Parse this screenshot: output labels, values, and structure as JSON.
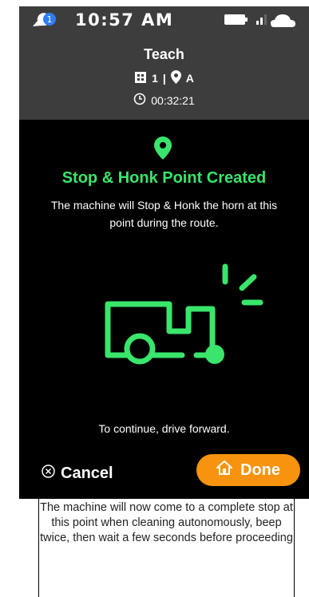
{
  "status_bar": {
    "time": "10:57 AM",
    "notification_count": "1",
    "icons": [
      "messenger-icon",
      "battery-icon",
      "signal-icon",
      "cloud-icon"
    ]
  },
  "header": {
    "title": "Teach",
    "route_number": "1",
    "separator": "|",
    "point_label": "A",
    "elapsed": "00:32:21"
  },
  "main": {
    "title": "Stop & Honk Point Created",
    "description": "The machine will Stop & Honk the horn at this point during the route.",
    "continue_text": "To continue, drive forward."
  },
  "actions": {
    "cancel_label": "Cancel",
    "done_label": "Done"
  },
  "note": {
    "text": "The machine will now come to a complete stop at this point when cleaning autonomously, beep twice, then wait a few seconds before proceeding"
  },
  "colors": {
    "accent_green": "#39e56b",
    "done_orange": "#f7930e",
    "header_gray": "#3d3d3d"
  }
}
